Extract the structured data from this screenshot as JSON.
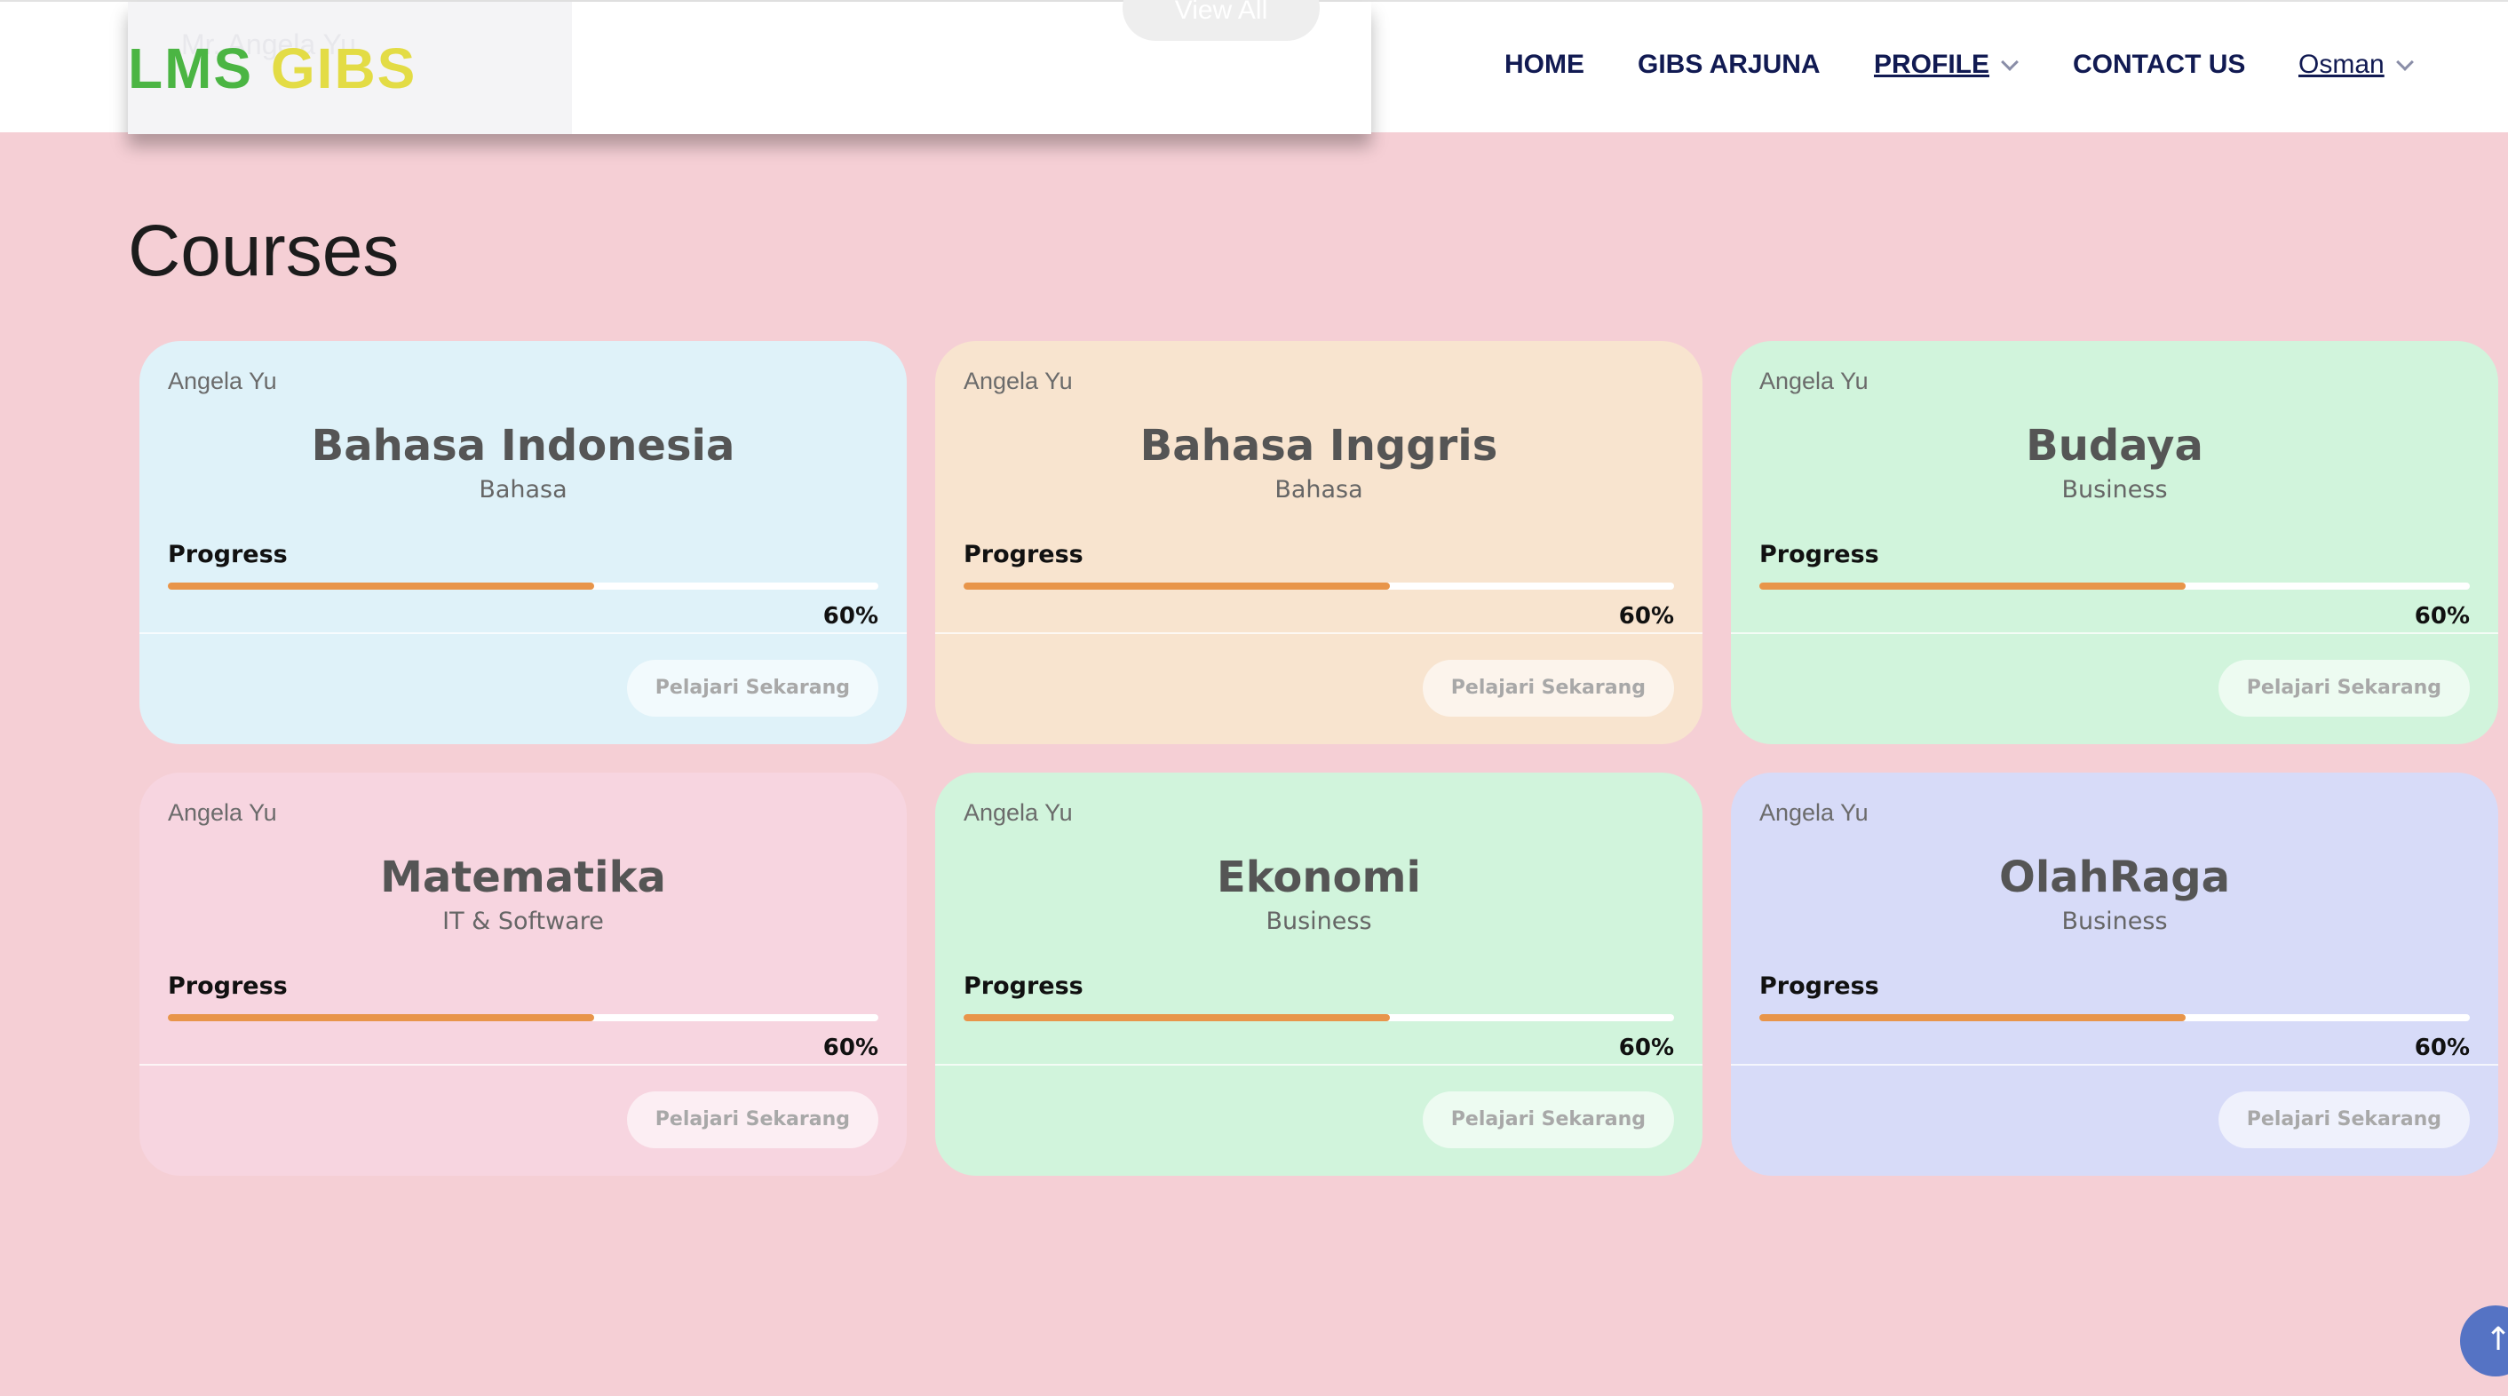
{
  "header": {
    "logo_part1": "LMS",
    "logo_part2": "GIBS",
    "ghost_name": "Mr. Angela Yu",
    "ghost_view_all": "View All",
    "nav": [
      {
        "label": "HOME"
      },
      {
        "label": "GIBS ARJUNA"
      },
      {
        "label": "PROFILE"
      },
      {
        "label": "CONTACT US"
      },
      {
        "label": "Osman"
      }
    ]
  },
  "section": {
    "title": "Courses"
  },
  "courses": [
    {
      "author": "Angela Yu",
      "title": "Bahasa Indonesia",
      "category": "Bahasa",
      "progress_label": "Progress",
      "progress": 60,
      "progress_text": "60%",
      "button": "Pelajari Sekarang",
      "color": "#dff2f9"
    },
    {
      "author": "Angela Yu",
      "title": "Bahasa Inggris",
      "category": "Bahasa",
      "progress_label": "Progress",
      "progress": 60,
      "progress_text": "60%",
      "button": "Pelajari Sekarang",
      "color": "#f8e4cf"
    },
    {
      "author": "Angela Yu",
      "title": "Budaya",
      "category": "Business",
      "progress_label": "Progress",
      "progress": 60,
      "progress_text": "60%",
      "button": "Pelajari Sekarang",
      "color": "#d1f4dc"
    },
    {
      "author": "Angela Yu",
      "title": "Matematika",
      "category": "IT & Software",
      "progress_label": "Progress",
      "progress": 60,
      "progress_text": "60%",
      "button": "Pelajari Sekarang",
      "color": "#f7d5e0"
    },
    {
      "author": "Angela Yu",
      "title": "Ekonomi",
      "category": "Business",
      "progress_label": "Progress",
      "progress": 60,
      "progress_text": "60%",
      "button": "Pelajari Sekarang",
      "color": "#d1f4dc"
    },
    {
      "author": "Angela Yu",
      "title": "OlahRaga",
      "category": "Business",
      "progress_label": "Progress",
      "progress": 60,
      "progress_text": "60%",
      "button": "Pelajari Sekarang",
      "color": "#d7dbf8"
    }
  ],
  "scroll_top_icon": "arrow-up-icon"
}
